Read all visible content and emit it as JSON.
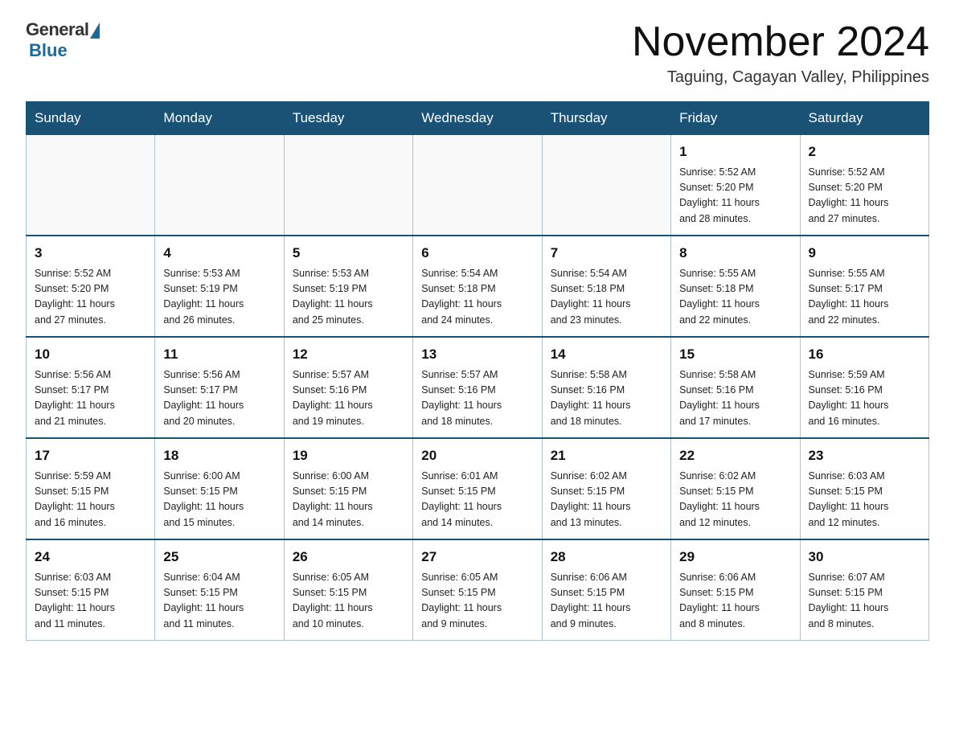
{
  "logo": {
    "general": "General",
    "blue": "Blue"
  },
  "header": {
    "title": "November 2024",
    "location": "Taguing, Cagayan Valley, Philippines"
  },
  "weekdays": [
    "Sunday",
    "Monday",
    "Tuesday",
    "Wednesday",
    "Thursday",
    "Friday",
    "Saturday"
  ],
  "weeks": [
    [
      {
        "day": "",
        "info": ""
      },
      {
        "day": "",
        "info": ""
      },
      {
        "day": "",
        "info": ""
      },
      {
        "day": "",
        "info": ""
      },
      {
        "day": "",
        "info": ""
      },
      {
        "day": "1",
        "info": "Sunrise: 5:52 AM\nSunset: 5:20 PM\nDaylight: 11 hours\nand 28 minutes."
      },
      {
        "day": "2",
        "info": "Sunrise: 5:52 AM\nSunset: 5:20 PM\nDaylight: 11 hours\nand 27 minutes."
      }
    ],
    [
      {
        "day": "3",
        "info": "Sunrise: 5:52 AM\nSunset: 5:20 PM\nDaylight: 11 hours\nand 27 minutes."
      },
      {
        "day": "4",
        "info": "Sunrise: 5:53 AM\nSunset: 5:19 PM\nDaylight: 11 hours\nand 26 minutes."
      },
      {
        "day": "5",
        "info": "Sunrise: 5:53 AM\nSunset: 5:19 PM\nDaylight: 11 hours\nand 25 minutes."
      },
      {
        "day": "6",
        "info": "Sunrise: 5:54 AM\nSunset: 5:18 PM\nDaylight: 11 hours\nand 24 minutes."
      },
      {
        "day": "7",
        "info": "Sunrise: 5:54 AM\nSunset: 5:18 PM\nDaylight: 11 hours\nand 23 minutes."
      },
      {
        "day": "8",
        "info": "Sunrise: 5:55 AM\nSunset: 5:18 PM\nDaylight: 11 hours\nand 22 minutes."
      },
      {
        "day": "9",
        "info": "Sunrise: 5:55 AM\nSunset: 5:17 PM\nDaylight: 11 hours\nand 22 minutes."
      }
    ],
    [
      {
        "day": "10",
        "info": "Sunrise: 5:56 AM\nSunset: 5:17 PM\nDaylight: 11 hours\nand 21 minutes."
      },
      {
        "day": "11",
        "info": "Sunrise: 5:56 AM\nSunset: 5:17 PM\nDaylight: 11 hours\nand 20 minutes."
      },
      {
        "day": "12",
        "info": "Sunrise: 5:57 AM\nSunset: 5:16 PM\nDaylight: 11 hours\nand 19 minutes."
      },
      {
        "day": "13",
        "info": "Sunrise: 5:57 AM\nSunset: 5:16 PM\nDaylight: 11 hours\nand 18 minutes."
      },
      {
        "day": "14",
        "info": "Sunrise: 5:58 AM\nSunset: 5:16 PM\nDaylight: 11 hours\nand 18 minutes."
      },
      {
        "day": "15",
        "info": "Sunrise: 5:58 AM\nSunset: 5:16 PM\nDaylight: 11 hours\nand 17 minutes."
      },
      {
        "day": "16",
        "info": "Sunrise: 5:59 AM\nSunset: 5:16 PM\nDaylight: 11 hours\nand 16 minutes."
      }
    ],
    [
      {
        "day": "17",
        "info": "Sunrise: 5:59 AM\nSunset: 5:15 PM\nDaylight: 11 hours\nand 16 minutes."
      },
      {
        "day": "18",
        "info": "Sunrise: 6:00 AM\nSunset: 5:15 PM\nDaylight: 11 hours\nand 15 minutes."
      },
      {
        "day": "19",
        "info": "Sunrise: 6:00 AM\nSunset: 5:15 PM\nDaylight: 11 hours\nand 14 minutes."
      },
      {
        "day": "20",
        "info": "Sunrise: 6:01 AM\nSunset: 5:15 PM\nDaylight: 11 hours\nand 14 minutes."
      },
      {
        "day": "21",
        "info": "Sunrise: 6:02 AM\nSunset: 5:15 PM\nDaylight: 11 hours\nand 13 minutes."
      },
      {
        "day": "22",
        "info": "Sunrise: 6:02 AM\nSunset: 5:15 PM\nDaylight: 11 hours\nand 12 minutes."
      },
      {
        "day": "23",
        "info": "Sunrise: 6:03 AM\nSunset: 5:15 PM\nDaylight: 11 hours\nand 12 minutes."
      }
    ],
    [
      {
        "day": "24",
        "info": "Sunrise: 6:03 AM\nSunset: 5:15 PM\nDaylight: 11 hours\nand 11 minutes."
      },
      {
        "day": "25",
        "info": "Sunrise: 6:04 AM\nSunset: 5:15 PM\nDaylight: 11 hours\nand 11 minutes."
      },
      {
        "day": "26",
        "info": "Sunrise: 6:05 AM\nSunset: 5:15 PM\nDaylight: 11 hours\nand 10 minutes."
      },
      {
        "day": "27",
        "info": "Sunrise: 6:05 AM\nSunset: 5:15 PM\nDaylight: 11 hours\nand 9 minutes."
      },
      {
        "day": "28",
        "info": "Sunrise: 6:06 AM\nSunset: 5:15 PM\nDaylight: 11 hours\nand 9 minutes."
      },
      {
        "day": "29",
        "info": "Sunrise: 6:06 AM\nSunset: 5:15 PM\nDaylight: 11 hours\nand 8 minutes."
      },
      {
        "day": "30",
        "info": "Sunrise: 6:07 AM\nSunset: 5:15 PM\nDaylight: 11 hours\nand 8 minutes."
      }
    ]
  ]
}
